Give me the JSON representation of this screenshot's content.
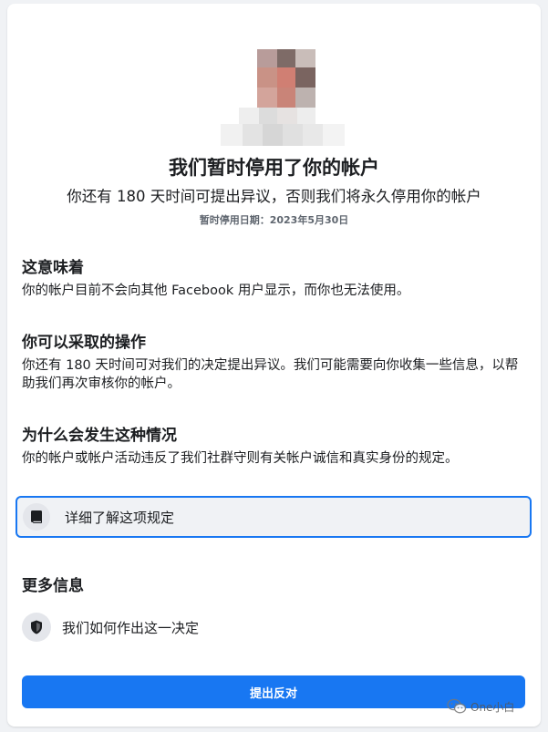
{
  "header": {
    "title": "我们暂时停用了你的帐户",
    "subtitle": "你还有 180 天时间可提出异议，否则我们将永久停用你的帐户",
    "date": "暂时停用日期：2023年5月30日"
  },
  "sections": {
    "meaning": {
      "heading": "这意味着",
      "body": "你的帐户目前不会向其他 Facebook 用户显示，而你也无法使用。"
    },
    "actions": {
      "heading": "你可以采取的操作",
      "body": "你还有 180 天时间可对我们的决定提出异议。我们可能需要向你收集一些信息，以帮助我们再次审核你的帐户。"
    },
    "why": {
      "heading": "为什么会发生这种情况",
      "body": "你的帐户或帐户活动违反了我们社群守则有关帐户诚信和真实身份的规定。",
      "learn_more": "详细了解这项规定"
    },
    "more": {
      "heading": "更多信息",
      "how_decided": "我们如何作出这一决定"
    }
  },
  "appeal_button": "提出反对",
  "watermark": "One小白",
  "icons": {
    "learn_more": "book-icon",
    "how_decided": "shield-icon",
    "watermark": "wechat-icon"
  },
  "colors": {
    "accent": "#1877f2",
    "background": "#f0f2f5"
  }
}
